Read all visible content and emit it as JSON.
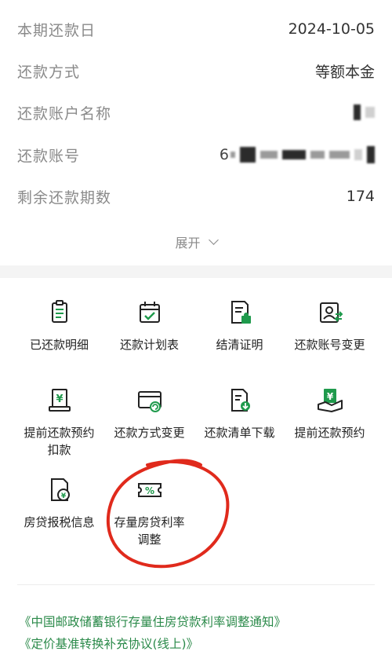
{
  "details": [
    {
      "label": "本期还款日",
      "value": "2024-10-05"
    },
    {
      "label": "还款方式",
      "value": "等额本金"
    },
    {
      "label": "还款账户名称",
      "value": ""
    },
    {
      "label": "还款账号",
      "value": "6"
    },
    {
      "label": "剩余还款期数",
      "value": "174"
    }
  ],
  "expand_label": "展开",
  "services": [
    {
      "label_lines": [
        "已还款明细"
      ],
      "icon": "document-list-icon"
    },
    {
      "label_lines": [
        "还款计划表"
      ],
      "icon": "calendar-check-icon"
    },
    {
      "label_lines": [
        "结清证明"
      ],
      "icon": "certificate-icon"
    },
    {
      "label_lines": [
        "还款账号变更"
      ],
      "icon": "account-change-icon"
    },
    {
      "label_lines": [
        "提前还款预约",
        "扣款"
      ],
      "icon": "yuan-receipt-icon"
    },
    {
      "label_lines": [
        "还款方式变更"
      ],
      "icon": "card-refresh-icon"
    },
    {
      "label_lines": [
        "还款清单下载"
      ],
      "icon": "file-download-icon"
    },
    {
      "label_lines": [
        "提前还款预约"
      ],
      "icon": "yuan-hand-icon"
    },
    {
      "label_lines": [
        "房贷报税信息"
      ],
      "icon": "tax-document-icon"
    },
    {
      "label_lines": [
        "存量房贷利率",
        "调整"
      ],
      "icon": "percent-ticket-icon"
    }
  ],
  "links": [
    "《中国邮政储蓄银行存量住房贷款利率调整通知》",
    "《定价基准转换补充协议(线上)》"
  ],
  "colors": {
    "accent_green": "#1f9a4c",
    "link_green": "#2b8a4a",
    "annotation_red": "#e02a1c"
  }
}
